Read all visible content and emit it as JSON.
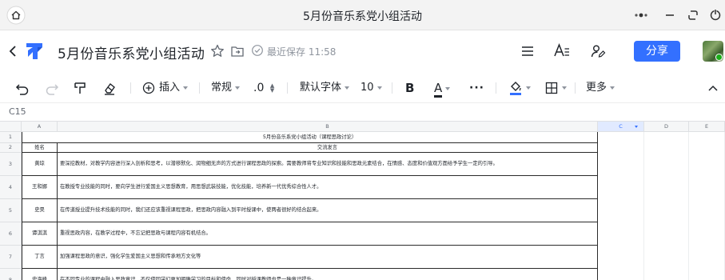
{
  "window": {
    "title": "5月份音乐系党小组活动"
  },
  "doc": {
    "title": "5月份音乐系党小组活动",
    "saved_status": "最近保存 11:58",
    "share_label": "分享"
  },
  "toolbar": {
    "insert_label": "插入",
    "format_label": "常规",
    "decimal_label": ".0",
    "font_label": "默认字体",
    "size_label": "10",
    "bold_label": "B",
    "fontcolor_label": "A",
    "more_dots": "···",
    "more_label": "更多",
    "fontcolor_hex": "#1f2329",
    "fill_hex": "#3370ff"
  },
  "cell_ref": "C15",
  "sheet": {
    "columns": [
      "A",
      "B",
      "C",
      "D",
      "E"
    ],
    "selected_column": "C",
    "rows": [
      "1",
      "2",
      "3",
      "4",
      "5",
      "6",
      "7",
      "8"
    ],
    "title": "5月份音乐系党小组活动（课程思政讨论）",
    "header": {
      "name": "姓名",
      "content": "交流发言"
    },
    "entries": [
      {
        "name": "黄琼",
        "text": "要深挖教材，对教学内容进行深入剖析和思考，以潜移默化、润物细无声的方式进行课程思政的探索。需要教师将专业知识和技能和思政元素结合，在情感、态度和价值观方面给予学生一定的引导。"
      },
      {
        "name": "王和娜",
        "text": "在教授专业技能的同时，要向学生进行爱国主义思想教育，用思想武装技能，优化技能，培养新一代优秀综合性人才。"
      },
      {
        "name": "史昊",
        "text": "在传道授业提升技术技能的同时，我们还应该重视课程思政，把思政内容融入到平时授课中，使两者很好的结合起来。"
      },
      {
        "name": "谭淇淇",
        "text": "重视思政内容，在教学过程中，不忘记把思政与课程内容有机结合。"
      },
      {
        "name": "丁言",
        "text": "加强课程思政的意识，强化学生爱国主义思想和传承地方文化等"
      },
      {
        "name": "史海峰",
        "text": "在不同专业的课程中融入思政意识，不仅使同学们更加明确学习的目标和使命，同时对授课教师也是一种意识提升。"
      }
    ]
  }
}
